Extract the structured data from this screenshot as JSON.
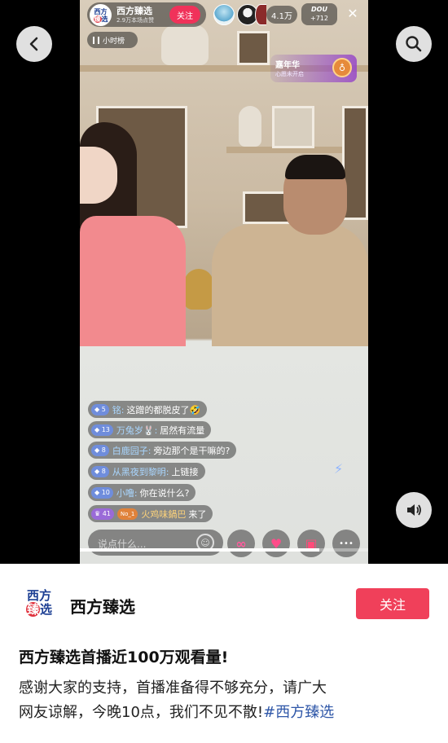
{
  "live": {
    "host_name": "西方臻选",
    "host_likes": "2.9万本场点赞",
    "logo_line1": "西方",
    "logo_line2_a": "臻",
    "logo_line2_b": "选",
    "follow_label": "关注",
    "viewer_count": "4.1万",
    "dou_label": "DOU",
    "dou_value": "+712",
    "close_glyph": "✕",
    "rank_label": "小时榜",
    "carnival_title": "嘉年华",
    "carnival_sub": "心愿未开启",
    "carnival_badge": "♁"
  },
  "chat": [
    {
      "level": "5",
      "user": "铭:",
      "text": "这蹭的都脱皮了🤣"
    },
    {
      "level": "13",
      "user": "万兔岁🐰:",
      "text": "居然有流量"
    },
    {
      "level": "8",
      "user": "白鹿园子:",
      "text": "旁边那个是干嘛的?"
    },
    {
      "level": "8",
      "user": "从黑夜到黎明:",
      "text": "上链接"
    },
    {
      "level": "10",
      "user": "小噜:",
      "text": "你在说什么?"
    }
  ],
  "join": {
    "level": "41",
    "tag": "No_1",
    "user": "火鸡味鍋巴",
    "text": "来了"
  },
  "bottom": {
    "say_placeholder": "说点什么...",
    "emoji_glyph": "☺",
    "icon_loop": "∞",
    "icon_heart": "♥",
    "icon_gift": "▣",
    "icon_more": "•••"
  },
  "playback": {
    "progress": 0.83
  },
  "post": {
    "logo_line1": "西方",
    "logo_line2_a": "臻",
    "logo_line2_b": "选",
    "account_name": "西方臻选",
    "follow_label": "关注",
    "title": "西方臻选首播近100万观看量!",
    "body_line1": "感谢大家的支持，首播准备得不够充分，请广大",
    "body_line2": "网友谅解，今晚10点，我们不见不散!",
    "hashtag": "#西方臻选"
  },
  "colors": {
    "accent": "#f0405a",
    "hashtag": "#2f57a8",
    "chat_user": "#a9d6ff"
  }
}
